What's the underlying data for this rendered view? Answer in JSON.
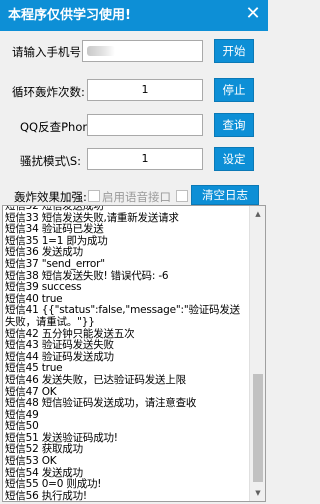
{
  "window": {
    "title": "本程序仅供学习使用!",
    "close_glyph": "✕"
  },
  "form": {
    "phone_label": "请输入手机号",
    "phone_value": "",
    "start_button": "开始",
    "loop_label": "循环轰炸次数:",
    "loop_value": "1",
    "stop_button": "停止",
    "qq_label": "QQ反查Phone:",
    "qq_value": "",
    "query_button": "查询",
    "interval_label": "骚扰模式\\S:",
    "interval_value": "1",
    "settings_button": "设定",
    "effect_label": "轰炸效果加强:",
    "voice_label": "启用语音接口",
    "clear_log_button": "清空日志"
  },
  "log": {
    "lines": [
      "短信32 短信发送成功",
      "短信33 短信发送失败,请重新发送请求",
      "短信34 验证码已发送",
      "短信35 1=1 即为成功",
      "短信36 发送成功",
      "短信37 \"send_error\"",
      "短信38 短信发送失败! 错误代码: -6",
      "短信39 success",
      "短信40 true",
      "短信41 {{\"status\":false,\"message\":\"验证码发送失败，请重试。\"}}",
      "短信42 五分钟只能发送五次",
      "短信43 验证码发送失败",
      "短信44 验证码发送成功",
      "短信45 true",
      "短信46 发送失败，已达验证码发送上限",
      "短信47 OK",
      "短信48 短信验证码发送成功，请注意查收",
      "短信49",
      "短信50",
      "短信51 发送验证码成功!",
      "短信52 获取成功",
      "短信53 OK",
      "短信54 发送成功",
      "短信55 0=0 则成功!",
      "短信56 执行成功!"
    ]
  },
  "colors": {
    "accent": "#0d8fd6",
    "panel": "#f0f0f0"
  }
}
